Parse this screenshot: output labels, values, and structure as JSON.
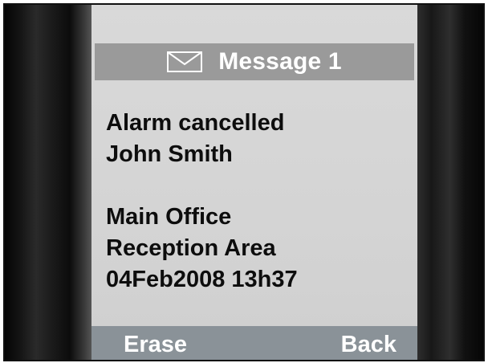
{
  "header": {
    "icon": "envelope-icon",
    "title": "Message 1"
  },
  "message": {
    "lines": [
      "Alarm cancelled",
      "John Smith"
    ],
    "location_lines": [
      "Main Office",
      "Reception Area",
      "04Feb2008 13h37"
    ]
  },
  "softkeys": {
    "left": "Erase",
    "right": "Back"
  },
  "colors": {
    "screen": "#d6d6d6",
    "title_bar": "#9a9a9a",
    "softkey_bar": "#8a9298",
    "text": "#0d0d0d"
  }
}
